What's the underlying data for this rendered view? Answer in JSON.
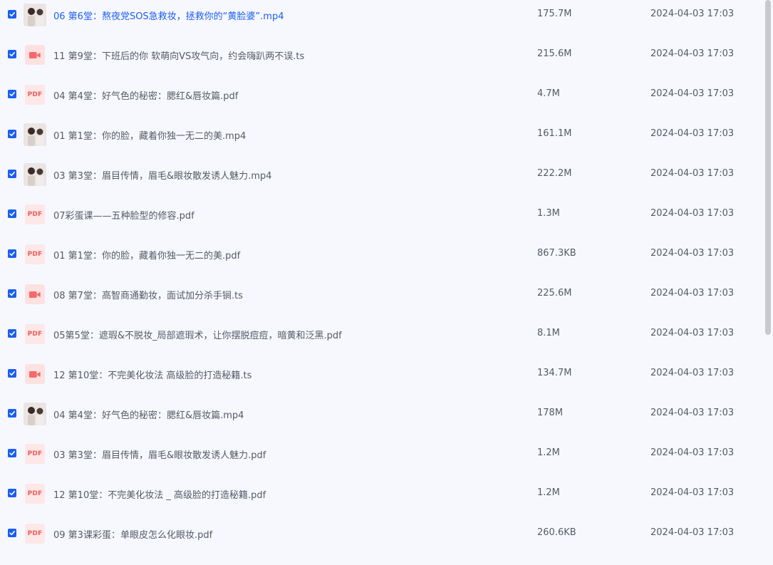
{
  "files": [
    {
      "name": "06 第6堂：熬夜党SOS急救妆，拯救你的“黄脸婆”.mp4",
      "size": "175.7M",
      "date": "2024-04-03 17:03",
      "type": "video-thumb",
      "active": true,
      "checked": true
    },
    {
      "name": "11 第9堂：下班后的你 软萌向VS攻气向，约会嗨趴两不误.ts",
      "size": "215.6M",
      "date": "2024-04-03 17:03",
      "type": "video",
      "active": false,
      "checked": true
    },
    {
      "name": "04 第4堂：好气色的秘密：腮红&唇妆篇.pdf",
      "size": "4.7M",
      "date": "2024-04-03 17:03",
      "type": "pdf",
      "active": false,
      "checked": true
    },
    {
      "name": "01 第1堂：你的脸，藏着你独一无二的美.mp4",
      "size": "161.1M",
      "date": "2024-04-03 17:03",
      "type": "video-thumb",
      "active": false,
      "checked": true
    },
    {
      "name": "03 第3堂：眉目传情，眉毛&眼妆散发诱人魅力.mp4",
      "size": "222.2M",
      "date": "2024-04-03 17:03",
      "type": "video-thumb",
      "active": false,
      "checked": true
    },
    {
      "name": "07彩蛋课——五种脸型的修容.pdf",
      "size": "1.3M",
      "date": "2024-04-03 17:03",
      "type": "pdf",
      "active": false,
      "checked": true
    },
    {
      "name": "01 第1堂：你的脸，藏着你独一无二的美.pdf",
      "size": "867.3KB",
      "date": "2024-04-03 17:03",
      "type": "pdf",
      "active": false,
      "checked": true
    },
    {
      "name": "08 第7堂：高智商通勤妆，面试加分杀手锏.ts",
      "size": "225.6M",
      "date": "2024-04-03 17:03",
      "type": "video",
      "active": false,
      "checked": true
    },
    {
      "name": "05第5堂：遮瑕&不脱妆_局部遮瑕术，让你摆脱痘痘，暗黄和泛黑.pdf",
      "size": "8.1M",
      "date": "2024-04-03 17:03",
      "type": "pdf",
      "active": false,
      "checked": true
    },
    {
      "name": "12 第10堂：不完美化妆法 高级脸的打造秘籍.ts",
      "size": "134.7M",
      "date": "2024-04-03 17:03",
      "type": "video",
      "active": false,
      "checked": true
    },
    {
      "name": "04 第4堂：好气色的秘密：腮红&唇妆篇.mp4",
      "size": "178M",
      "date": "2024-04-03 17:03",
      "type": "video-thumb",
      "active": false,
      "checked": true
    },
    {
      "name": "03 第3堂：眉目传情，眉毛&眼妆散发诱人魅力.pdf",
      "size": "1.2M",
      "date": "2024-04-03 17:03",
      "type": "pdf",
      "active": false,
      "checked": true
    },
    {
      "name": "12 第10堂：不完美化妆法 _ 高级脸的打造秘籍.pdf",
      "size": "1.2M",
      "date": "2024-04-03 17:03",
      "type": "pdf",
      "active": false,
      "checked": true
    },
    {
      "name": "09 第3课彩蛋：单眼皮怎么化眼妆.pdf",
      "size": "260.6KB",
      "date": "2024-04-03 17:03",
      "type": "pdf",
      "active": false,
      "checked": true
    }
  ],
  "pdf_badge": "PDF",
  "icons": {
    "checkbox": "checkbox-checked-icon",
    "pdf": "pdf-file-icon",
    "video": "video-camera-icon",
    "thumbnail": "video-thumbnail"
  },
  "colors": {
    "accent": "#1a5ef2",
    "text": "#555a66",
    "background": "#f7f8fe",
    "pdf_red": "#f25b5b",
    "pdf_bg": "#fde7e7",
    "video_red": "#f46a6a",
    "video_bg": "#fde1e1"
  }
}
